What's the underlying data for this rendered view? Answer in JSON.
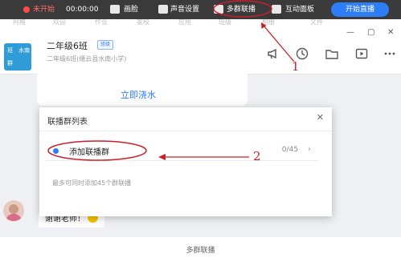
{
  "toolbar": {
    "status": "未开始",
    "timer": "00:00:00",
    "items": [
      "画脸",
      "声音设置",
      "多群联播",
      "互动面板"
    ],
    "start_button": "开始直播"
  },
  "header": {
    "tabs_ghost": [
      "阿格",
      "欢迎",
      "作业",
      "家校",
      "应用",
      "班级",
      "相册",
      "文件"
    ],
    "avatar_lines": [
      "班",
      "水南",
      "群"
    ],
    "class_name": "二年级6班",
    "badge": "班级",
    "school": "二年级6班(缙云县水南小学)",
    "window_controls": [
      "—",
      "▢",
      "✕"
    ],
    "icons": [
      "megaphone-icon",
      "clock-icon",
      "folder-icon",
      "play-icon",
      "more-icon"
    ]
  },
  "chat": {
    "water_action": "立即浇水",
    "message": "谢谢老师！"
  },
  "dialog": {
    "title": "联播群列表",
    "close": "✕",
    "add_group": "添加联播群",
    "count": "0/45",
    "chevron": "›",
    "hint": "最多可同时添加45个群联播"
  },
  "annotations": {
    "marker_1": "1",
    "marker_2": "2",
    "accent": "#c8202a"
  },
  "caption": "多群联播"
}
